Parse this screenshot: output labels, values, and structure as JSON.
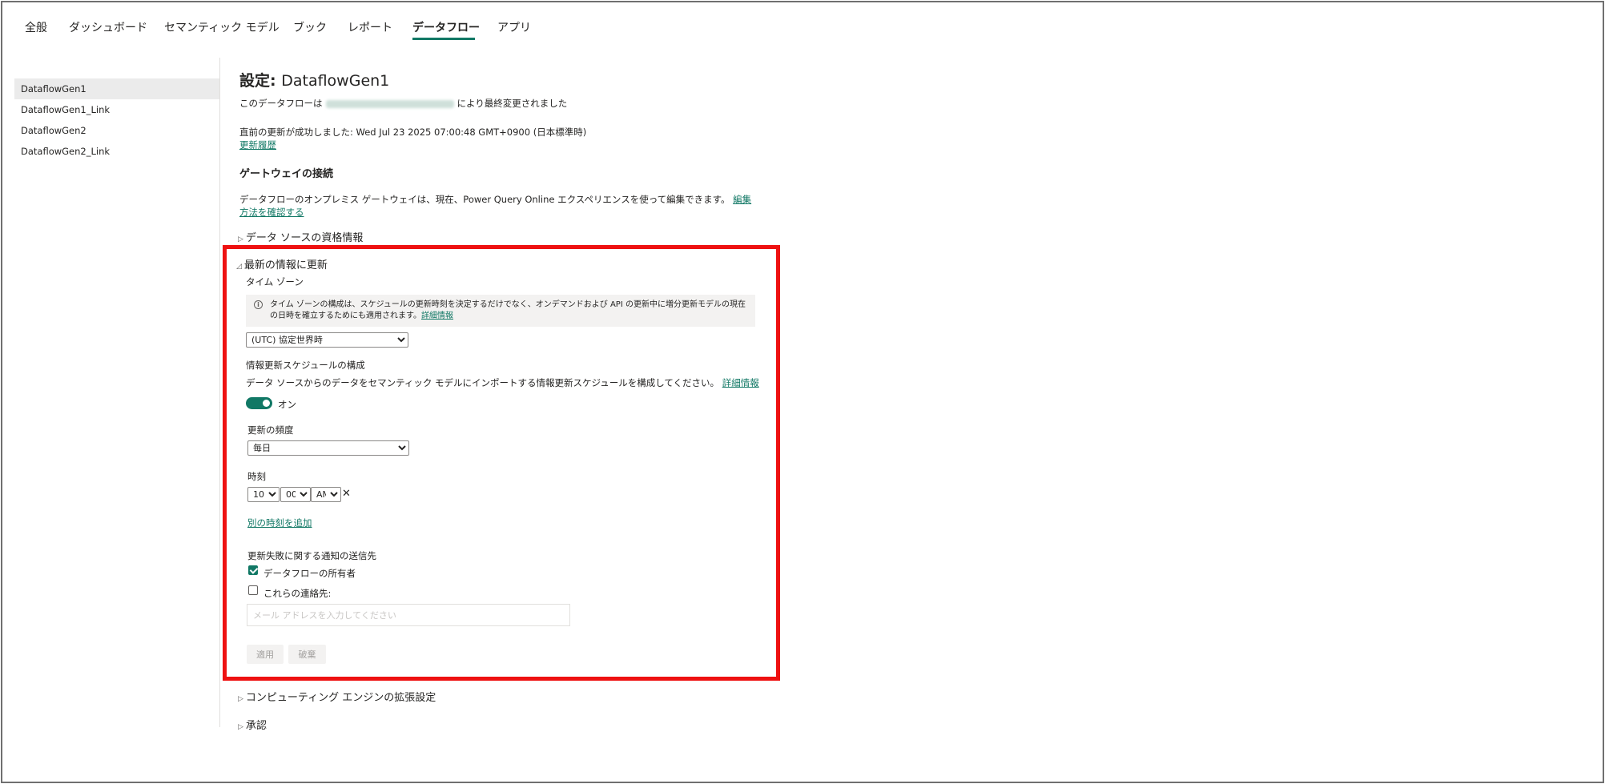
{
  "tabs": [
    {
      "label": "全般"
    },
    {
      "label": "ダッシュボード"
    },
    {
      "label": "セマンティック モデル"
    },
    {
      "label": "ブック"
    },
    {
      "label": "レポート"
    },
    {
      "label": "データフロー"
    },
    {
      "label": "アプリ"
    }
  ],
  "sidebar": {
    "items": [
      {
        "label": "DataflowGen1"
      },
      {
        "label": "DataflowGen1_Link"
      },
      {
        "label": "DataflowGen2"
      },
      {
        "label": "DataflowGen2_Link"
      }
    ]
  },
  "main": {
    "title_prefix": "設定: ",
    "title_name": "DataflowGen1",
    "modified_before": "このデータフローは",
    "modified_after": "により最終変更されました",
    "last_refresh": "直前の更新が成功しました: Wed Jul 23 2025 07:00:48 GMT+0900 (日本標準時)",
    "refresh_history_link": "更新履歴",
    "gateway_heading": "ゲートウェイの接続",
    "gateway_text": "データフローのオンプレミス ゲートウェイは、現在、Power Query Online エクスペリエンスを使って編集できます。",
    "gateway_link": "編集方法を確認する",
    "datasource_section": "データ ソースの資格情報",
    "refresh_section": "最新の情報に更新",
    "timezone_label": "タイム ゾーン",
    "timezone_info": "タイム ゾーンの構成は、スケジュールの更新時刻を決定するだけでなく、オンデマンドおよび API の更新中に増分更新モデルの現在の日時を確立するためにも適用されます。",
    "timezone_info_link": "詳細情報",
    "timezone_value": "(UTC) 協定世界時",
    "schedule_heading": "情報更新スケジュールの構成",
    "schedule_text": "データ ソースからのデータをセマンティック モデルにインポートする情報更新スケジュールを構成してください。",
    "schedule_link": "詳細情報",
    "toggle_label": "オン",
    "frequency_label": "更新の頻度",
    "frequency_value": "毎日",
    "time_label": "時刻",
    "time_hour": "10",
    "time_minute": "00",
    "time_ampm": "AM",
    "clear_symbol": "✕",
    "add_time_link": "別の時刻を追加",
    "notify_heading": "更新失敗に関する通知の送信先",
    "notify_owner": "データフローの所有者",
    "notify_contacts": "これらの連絡先:",
    "email_placeholder": "メール アドレスを入力してください",
    "apply_button": "適用",
    "discard_button": "破棄",
    "compute_section": "コンピューティング エンジンの拡張設定",
    "endorse_section": "承認"
  },
  "colors": {
    "accent": "#117865",
    "highlight": "#ee1111"
  }
}
